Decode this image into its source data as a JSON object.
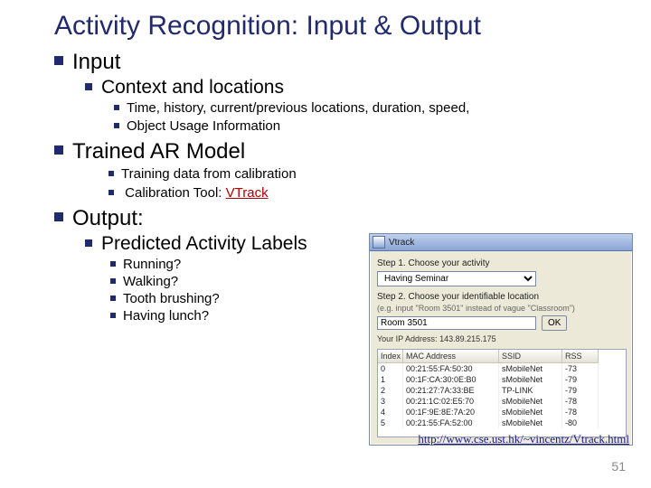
{
  "title": "Activity Recognition: Input & Output",
  "sections": [
    {
      "heading": "Input",
      "items": [
        {
          "heading": "Context and locations",
          "items": [
            "Time, history, current/previous locations, duration, speed,",
            "Object Usage Information"
          ]
        }
      ]
    },
    {
      "heading": "Trained AR Model",
      "sub": [
        "Training data from calibration",
        {
          "prefix": "Calibration Tool: ",
          "link_text": "VTrack"
        }
      ]
    },
    {
      "heading": "Output:",
      "items": [
        {
          "heading": "Predicted Activity Labels",
          "items": [
            "Running?",
            "Walking?",
            "Tooth brushing?",
            "Having lunch?"
          ]
        }
      ]
    }
  ],
  "footer_url": "http://www.cse.ust.hk/~vincentz/Vtrack.html",
  "page_number": "51",
  "app": {
    "title": "Vtrack",
    "step1_label": "Step 1. Choose your activity",
    "activity_selected": "Having Seminar",
    "step2_label": "Step 2. Choose your identifiable location",
    "step2_hint": "(e.g. input \"Room 3501\" instead of vague \"Classroom\")",
    "location_value": "Room 3501",
    "ok_label": "OK",
    "your_ip_label": "Your IP Address:",
    "your_ip_value": "143.89.215.175",
    "columns": [
      "Index",
      "MAC Address",
      "SSID",
      "RSS"
    ],
    "rows": [
      [
        "0",
        "00:21:55:FA:50:30",
        "sMobileNet",
        "-73"
      ],
      [
        "1",
        "00:1F:CA:30:0E:B0",
        "sMobileNet",
        "-79"
      ],
      [
        "2",
        "00:21:27:7A:33:BE",
        "TP-LINK",
        "-79"
      ],
      [
        "3",
        "00:21:1C:02:E5:70",
        "sMobileNet",
        "-78"
      ],
      [
        "4",
        "00:1F:9E:8E:7A:20",
        "sMobileNet",
        "-78"
      ],
      [
        "5",
        "00:21:55:FA:52:00",
        "sMobileNet",
        "-80"
      ]
    ]
  }
}
